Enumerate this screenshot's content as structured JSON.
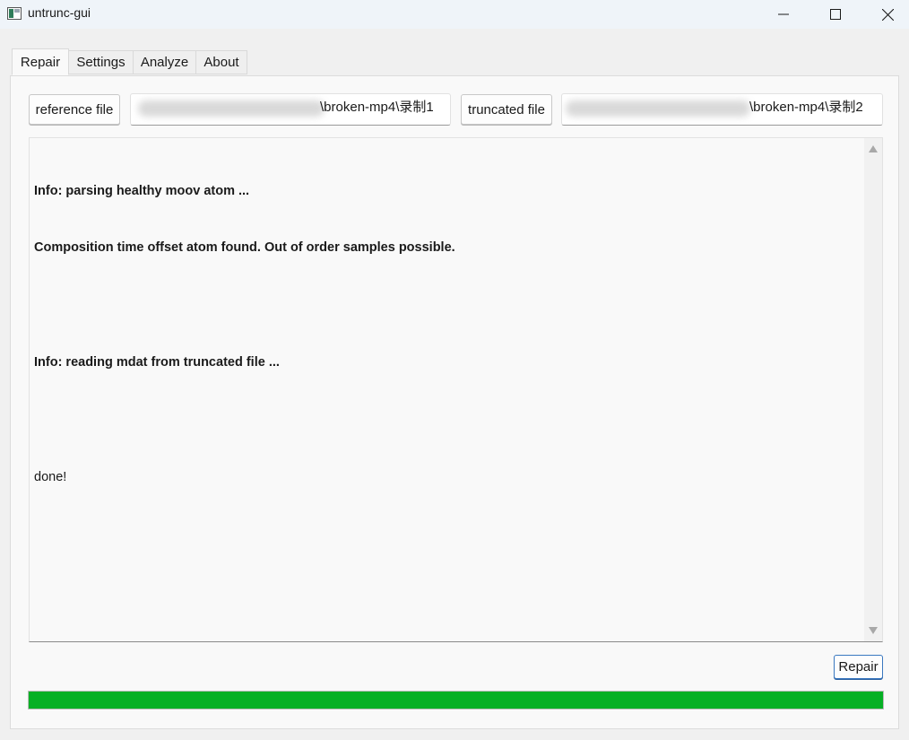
{
  "window": {
    "title": "untrunc-gui"
  },
  "tabs": [
    {
      "label": "Repair",
      "active": true
    },
    {
      "label": "Settings",
      "active": false
    },
    {
      "label": "Analyze",
      "active": false
    },
    {
      "label": "About",
      "active": false
    }
  ],
  "repair": {
    "reference_button": "reference file",
    "reference_path": "\\broken-mp4\\录制1",
    "truncated_button": "truncated file",
    "truncated_path": "\\broken-mp4\\录制2",
    "log_lines": [
      "Info: parsing healthy moov atom ...",
      "Composition time offset atom found. Out of order samples possible.",
      "",
      "Info: reading mdat from truncated file ...",
      "",
      "done!"
    ],
    "repair_button": "Repair",
    "progress": 1.0
  },
  "colors": {
    "progress_fill": "#06b025",
    "accent_border": "#3a78c0"
  },
  "icons": {
    "app": "app-window-icon",
    "minimize": "minimize-icon",
    "maximize": "maximize-icon",
    "close": "close-icon",
    "scroll_up": "scroll-up-arrow-icon",
    "scroll_down": "scroll-down-arrow-icon"
  }
}
